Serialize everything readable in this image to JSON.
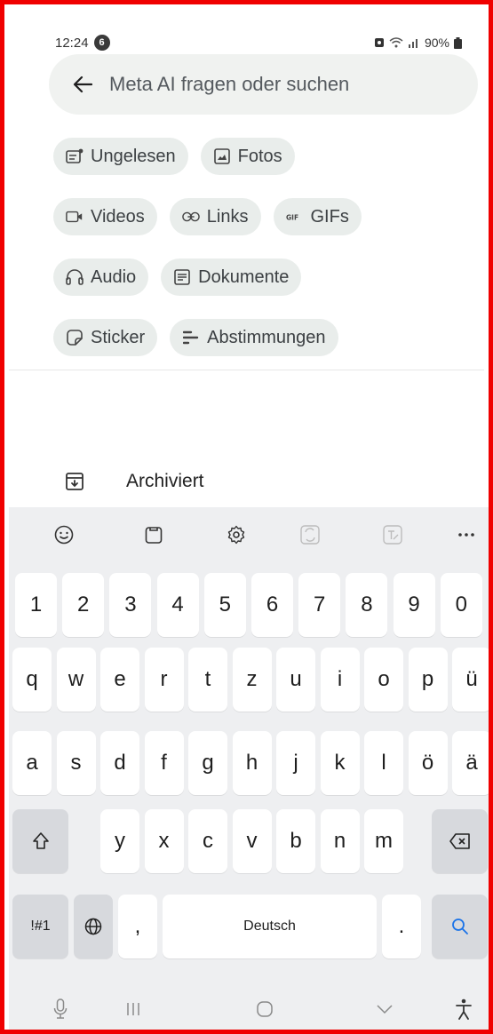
{
  "status_bar": {
    "time": "12:24",
    "notification_count": "6",
    "battery": "90%"
  },
  "search": {
    "placeholder": "Meta AI fragen oder suchen"
  },
  "filters": {
    "row1": [
      {
        "label": "Ungelesen",
        "icon": "unread-icon"
      },
      {
        "label": "Fotos",
        "icon": "photo-icon"
      }
    ],
    "row2": [
      {
        "label": "Videos",
        "icon": "video-icon"
      },
      {
        "label": "Links",
        "icon": "link-icon"
      },
      {
        "label": "GIFs",
        "icon": "gif-icon"
      }
    ],
    "row3": [
      {
        "label": "Audio",
        "icon": "headphones-icon"
      },
      {
        "label": "Dokumente",
        "icon": "document-icon"
      }
    ],
    "row4": [
      {
        "label": "Sticker",
        "icon": "sticker-icon"
      },
      {
        "label": "Abstimmungen",
        "icon": "poll-icon"
      }
    ]
  },
  "archived": {
    "label": "Archiviert"
  },
  "keyboard": {
    "numbers": [
      "1",
      "2",
      "3",
      "4",
      "5",
      "6",
      "7",
      "8",
      "9",
      "0"
    ],
    "row1": [
      "q",
      "w",
      "e",
      "r",
      "t",
      "z",
      "u",
      "i",
      "o",
      "p",
      "ü"
    ],
    "row2": [
      "a",
      "s",
      "d",
      "f",
      "g",
      "h",
      "j",
      "k",
      "l",
      "ö",
      "ä"
    ],
    "row3": [
      "y",
      "x",
      "c",
      "v",
      "b",
      "n",
      "m"
    ],
    "symbols_label": "!#1",
    "comma": ",",
    "space_label": "Deutsch",
    "period": ".",
    "accent_color": "#1a73e8"
  }
}
